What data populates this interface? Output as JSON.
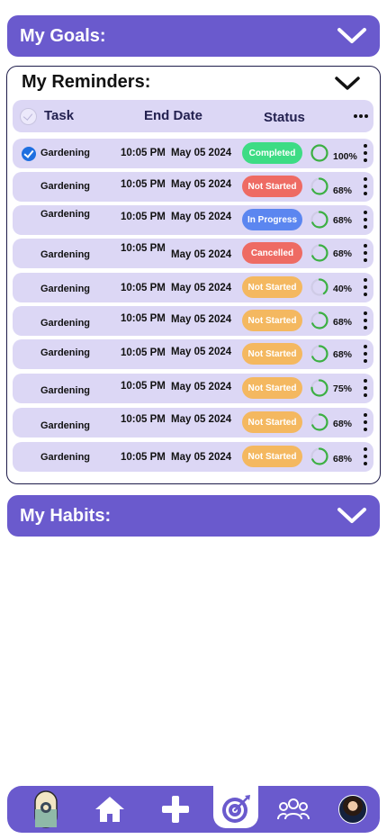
{
  "goals": {
    "title": "My Goals:"
  },
  "reminders": {
    "title": "My Reminders:",
    "columns": {
      "task": "Task",
      "end_date": "End Date",
      "status": "Status"
    },
    "rows": [
      {
        "task": "Gardening",
        "time": "10:05 PM",
        "date": "May 05 2024",
        "status": "Completed",
        "status_color": "#3ddc84",
        "progress": 100,
        "pct": "100%",
        "checked": true
      },
      {
        "task": "Gardening",
        "time": "10:05 PM",
        "date": "May 05 2024",
        "status": "Not Started",
        "status_color": "#ee6b63",
        "progress": 68,
        "pct": "68%",
        "checked": false
      },
      {
        "task": "Gardening",
        "time": "10:05 PM",
        "date": "May 05 2024",
        "status": "In Progress",
        "status_color": "#5b86f0",
        "progress": 68,
        "pct": "68%",
        "checked": false
      },
      {
        "task": "Gardening",
        "time": "10:05 PM",
        "date": "May 05 2024",
        "status": "Cancelled",
        "status_color": "#ee6b63",
        "progress": 68,
        "pct": "68%",
        "checked": false
      },
      {
        "task": "Gardening",
        "time": "10:05 PM",
        "date": "May 05 2024",
        "status": "Not Started",
        "status_color": "#f4b860",
        "progress": 40,
        "pct": "40%",
        "checked": false
      },
      {
        "task": "Gardening",
        "time": "10:05 PM",
        "date": "May 05 2024",
        "status": "Not Started",
        "status_color": "#f4b860",
        "progress": 68,
        "pct": "68%",
        "checked": false
      },
      {
        "task": "Gardening",
        "time": "10:05 PM",
        "date": "May 05 2024",
        "status": "Not Started",
        "status_color": "#f4b860",
        "progress": 68,
        "pct": "68%",
        "checked": false
      },
      {
        "task": "Gardening",
        "time": "10:05 PM",
        "date": "May 05 2024",
        "status": "Not Started",
        "status_color": "#f4b860",
        "progress": 75,
        "pct": "75%",
        "checked": false
      },
      {
        "task": "Gardening",
        "time": "10:05 PM",
        "date": "May 05 2024",
        "status": "Not Started",
        "status_color": "#f4b860",
        "progress": 68,
        "pct": "68%",
        "checked": false
      },
      {
        "task": "Gardening",
        "time": "10:05 PM",
        "date": "May 05 2024",
        "status": "Not Started",
        "status_color": "#f4b860",
        "progress": 68,
        "pct": "68%",
        "checked": false
      }
    ]
  },
  "habits": {
    "title": "My Habits:"
  },
  "nav": {
    "items": [
      "capsule-icon",
      "home-icon",
      "add-icon",
      "target-icon",
      "group-icon",
      "profile-avatar"
    ],
    "active": "target-icon"
  },
  "colors": {
    "accent": "#6a5acd",
    "row_bg": "#dcd7f5",
    "ring_green": "#3cb043"
  }
}
